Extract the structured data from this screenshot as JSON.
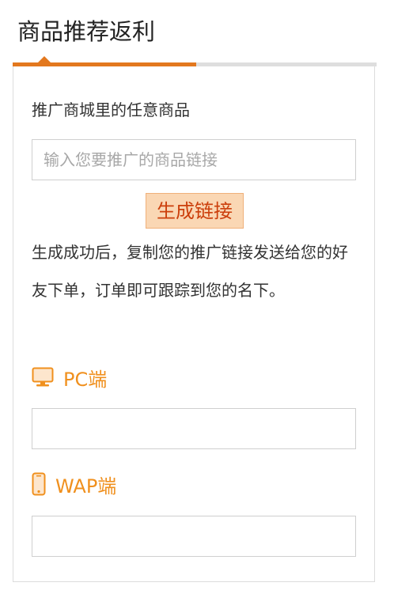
{
  "header": {
    "title": "商品推荐返利"
  },
  "promo": {
    "subtitle": "推广商城里的任意商品",
    "input_placeholder": "输入您要推广的商品链接",
    "input_value": "",
    "generate_label": "生成链接",
    "description": "生成成功后，复制您的推广链接发送给您的好友下单，订单即可跟踪到您的名下。"
  },
  "pc": {
    "icon": "desktop-monitor-icon",
    "label": "PC端",
    "value": ""
  },
  "wap": {
    "icon": "mobile-phone-icon",
    "label": "WAP端",
    "value": ""
  },
  "colors": {
    "accent_orange": "#e3781e",
    "section_orange": "#f0901e",
    "button_bg": "#fad7b4",
    "button_text": "#cc3f0c",
    "border_gray": "#cfcfcf"
  }
}
